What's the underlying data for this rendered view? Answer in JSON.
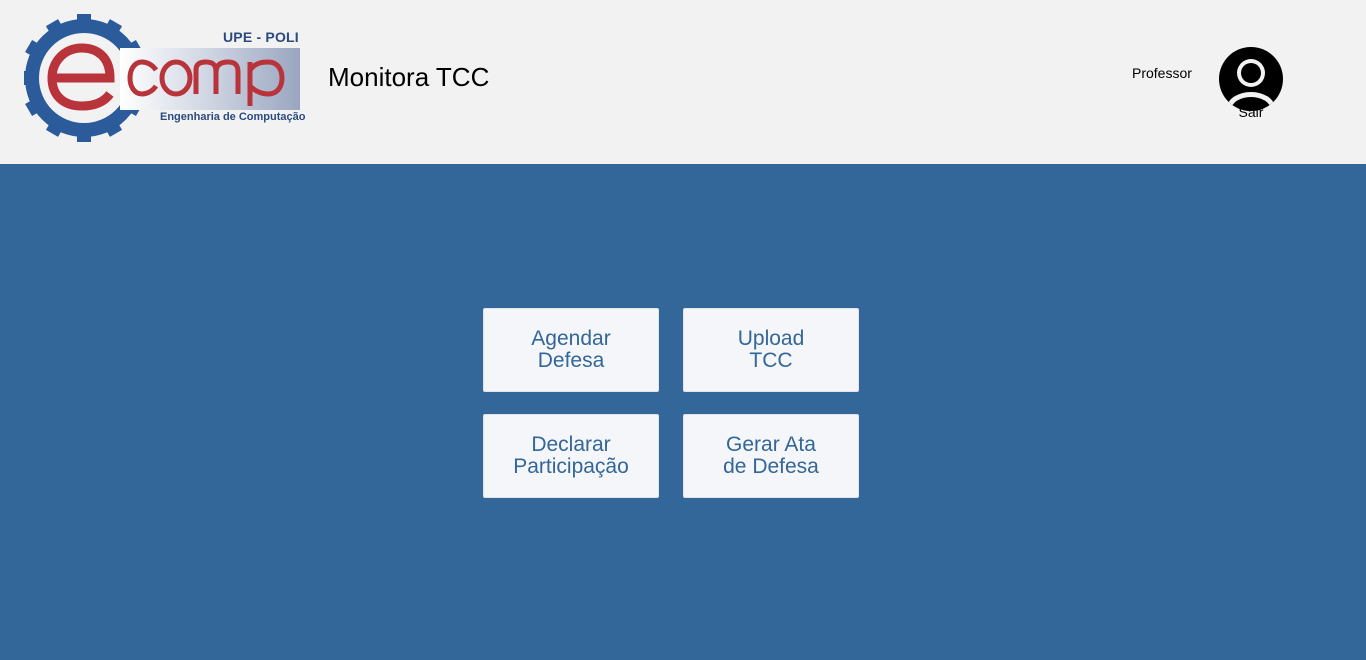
{
  "header": {
    "logo": {
      "top_text": "UPE - POLI",
      "wordmark": "ecomp",
      "subtitle": "Engenharia de Computação"
    },
    "app_title": "Monitora TCC",
    "user": {
      "role": "Professor",
      "logout_label": "Sair",
      "avatar_icon": "user-avatar-icon"
    }
  },
  "main": {
    "tiles": [
      {
        "label": "Agendar\nDefesa"
      },
      {
        "label": "Upload\nTCC"
      },
      {
        "label": "Declarar\nParticipação"
      },
      {
        "label": "Gerar Ata\nde Defesa"
      }
    ]
  },
  "colors": {
    "header_bg": "#f2f2f2",
    "main_bg": "#336699",
    "tile_bg": "#f4f6f9",
    "tile_text": "#336699",
    "logo_red": "#b8333a",
    "logo_blue": "#2b4a80"
  }
}
